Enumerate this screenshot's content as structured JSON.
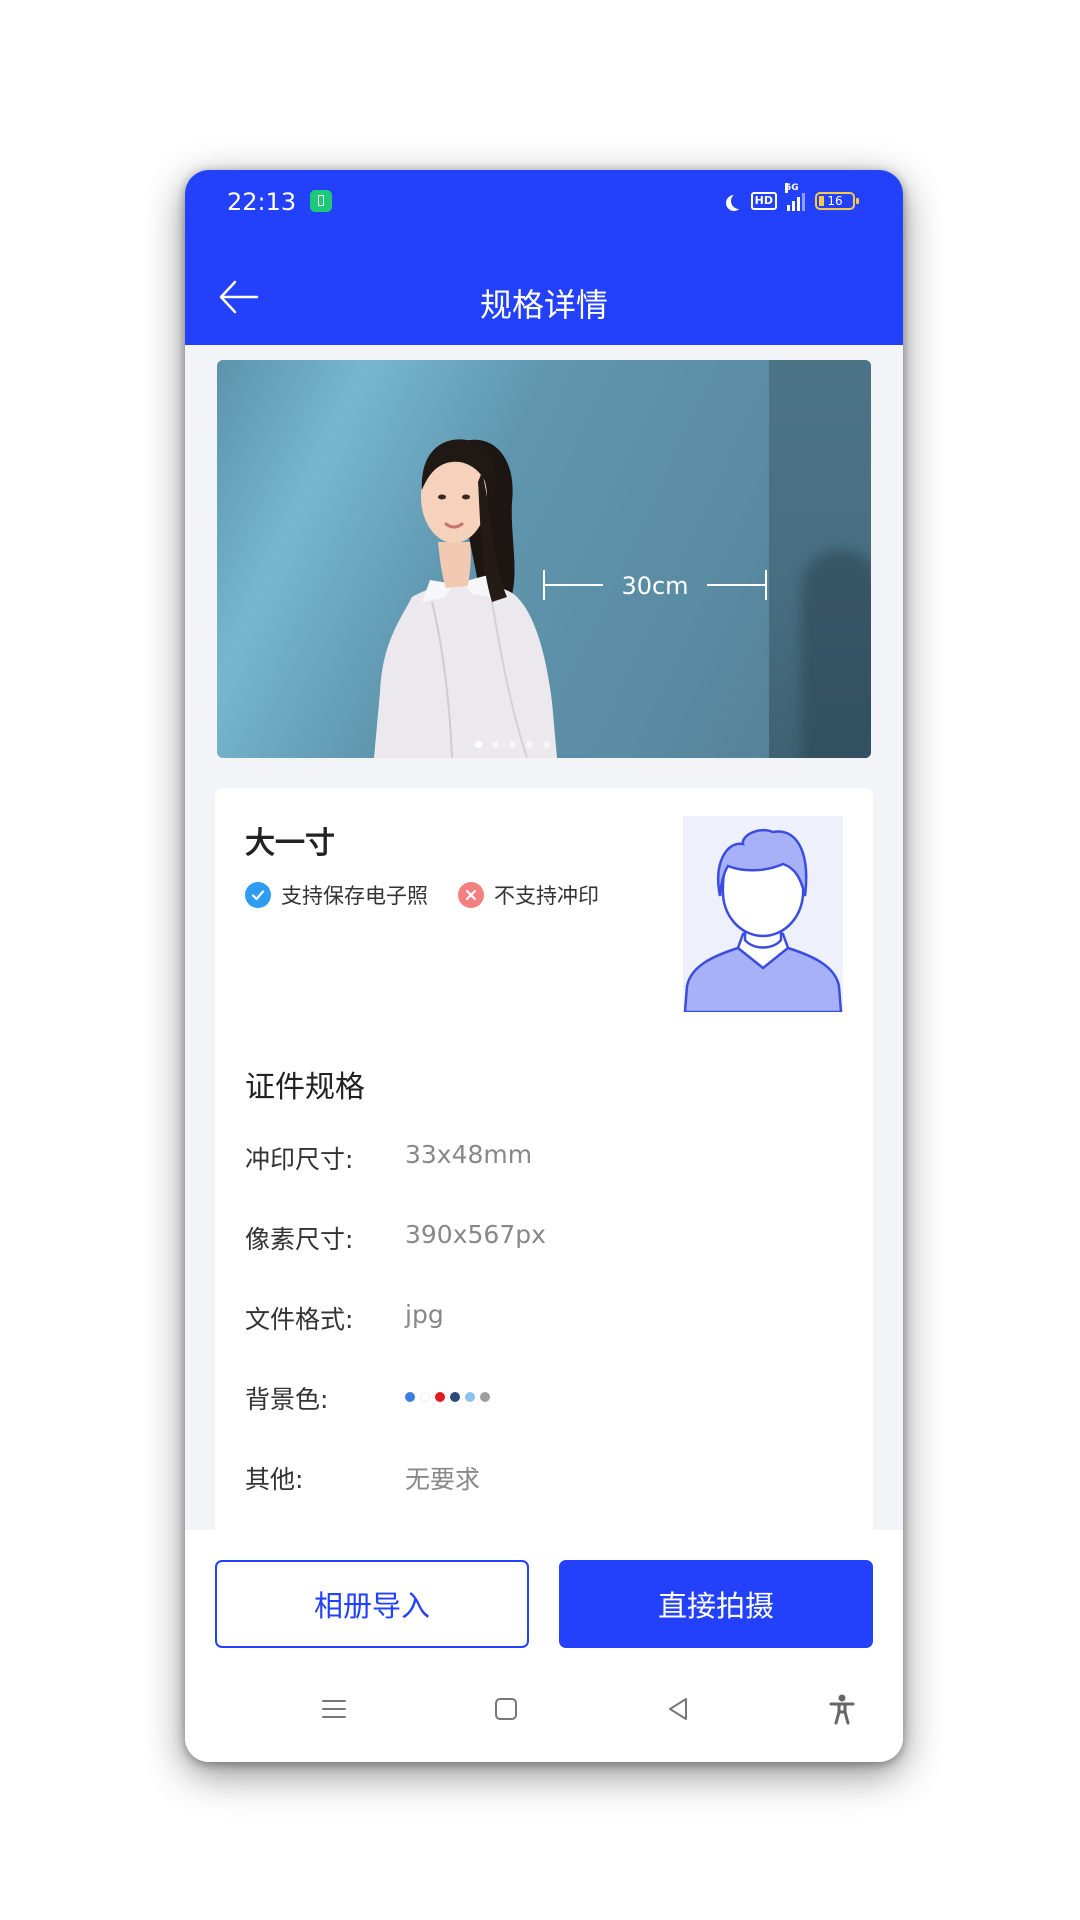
{
  "status_bar": {
    "time": "22:13",
    "battery_level": "16",
    "network": "5G",
    "hd_label": "HD",
    "icons": [
      "battery-app-icon",
      "moon-icon",
      "hd-icon",
      "signal-icon",
      "battery-icon"
    ]
  },
  "header": {
    "title": "规格详情",
    "back_icon": "arrow-left-icon"
  },
  "hero": {
    "measure_label": "30cm",
    "carousel_pages": 5,
    "active_page": 1
  },
  "spec": {
    "name": "大一寸",
    "badges": [
      {
        "label": "支持保存电子照",
        "icon": "check-circle-icon",
        "color": "#2f9cf1"
      },
      {
        "label": "不支持冲印",
        "icon": "close-circle-icon",
        "color": "#f37f7f"
      }
    ]
  },
  "details": {
    "title": "证件规格",
    "rows": [
      {
        "label": "冲印尺寸:",
        "value": "33x48mm"
      },
      {
        "label": "像素尺寸:",
        "value": "390x567px"
      },
      {
        "label": "文件格式:",
        "value": "jpg"
      },
      {
        "label": "背景色:",
        "value": ""
      },
      {
        "label": "其他:",
        "value": "无要求"
      }
    ],
    "background_colors": [
      "#3b7fdc",
      "#ffffff",
      "#e11b22",
      "#2a4a78",
      "#8ec2ee",
      "#9e9e9e"
    ]
  },
  "actions": {
    "import_label": "相册导入",
    "shoot_label": "直接拍摄"
  },
  "system_nav": {
    "icons": [
      "menu-icon",
      "home-icon",
      "back-triangle-icon",
      "accessibility-icon"
    ]
  },
  "colors": {
    "primary": "#2340fa",
    "background": "#f3f4f8"
  }
}
